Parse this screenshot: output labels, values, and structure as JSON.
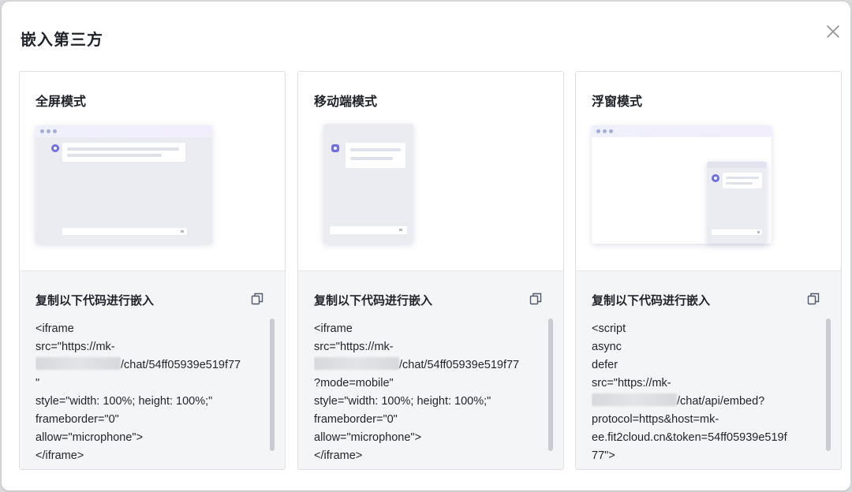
{
  "dialog": {
    "title": "嵌入第三方",
    "close_icon": "close-icon"
  },
  "cards": [
    {
      "title": "全屏模式",
      "copy_label": "复制以下代码进行嵌入",
      "code_lines": [
        "<iframe",
        "src=\"https://mk-",
        "/chat/54ff05939e519f77",
        "\"",
        "style=\"width: 100%; height: 100%;\"",
        "frameborder=\"0\"",
        "allow=\"microphone\">",
        "</iframe>"
      ]
    },
    {
      "title": "移动端模式",
      "copy_label": "复制以下代码进行嵌入",
      "code_lines": [
        "<iframe",
        "src=\"https://mk-",
        "/chat/54ff05939e519f77",
        "?mode=mobile\"",
        "style=\"width: 100%; height: 100%;\"",
        "frameborder=\"0\"",
        "allow=\"microphone\">",
        "</iframe>"
      ]
    },
    {
      "title": "浮窗模式",
      "copy_label": "复制以下代码进行嵌入",
      "code_lines": [
        "<script",
        "async",
        "defer",
        "src=\"https://mk-",
        "/chat/api/embed?",
        "protocol=https&host=mk-",
        "ee.fit2cloud.cn&token=54ff05939e519f",
        "77\">"
      ]
    }
  ],
  "colors": {
    "accent": "#6d6ee6",
    "panel_bg": "#f4f5f7",
    "border": "#dee0e3"
  }
}
